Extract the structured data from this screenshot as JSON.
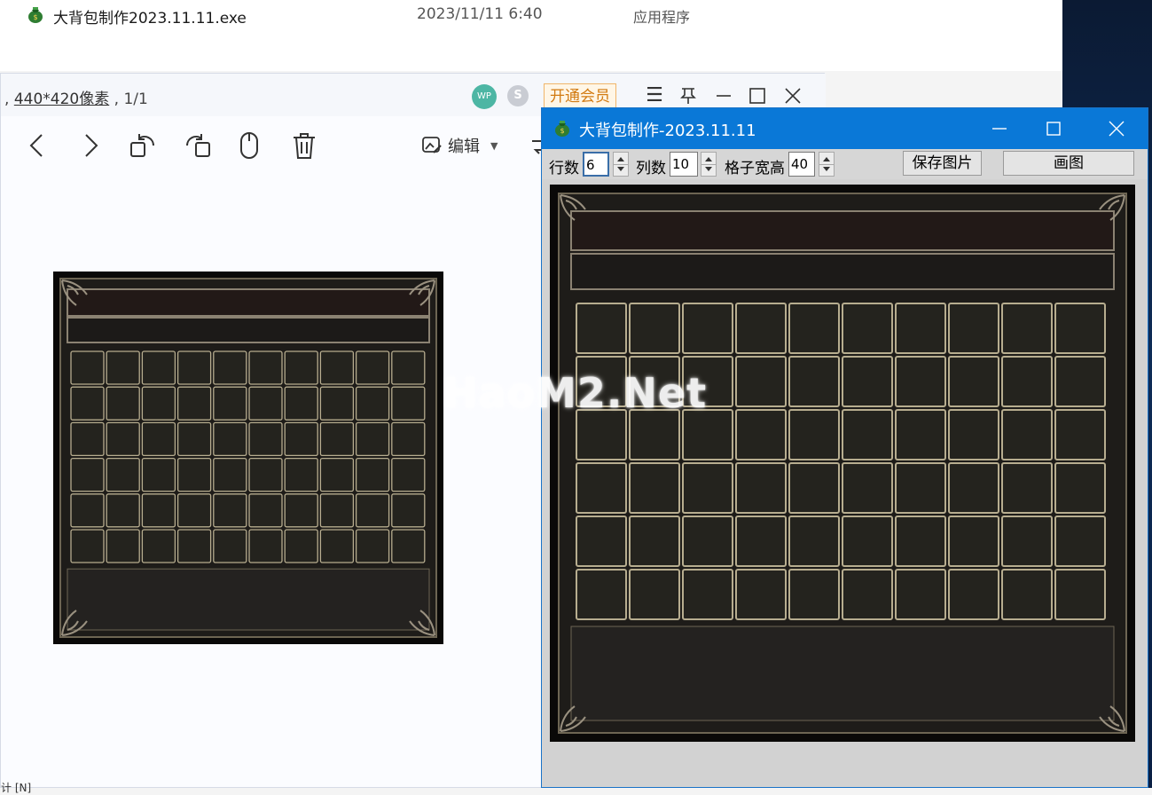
{
  "explorer": {
    "file_name": "大背包制作2023.11.11.exe",
    "file_date": "2023/11/11 6:40",
    "file_type": "应用程序"
  },
  "viewer": {
    "info_dims": "440*420像素",
    "info_sep": " , ",
    "info_page": "1/1",
    "wp_badge": "WP",
    "s_badge": "S",
    "vip_label": "开通会员",
    "edit_label": "编辑",
    "status_text": "计 [N]"
  },
  "tool": {
    "title": "大背包制作-2023.11.11",
    "rows_label": "行数",
    "rows_value": "6",
    "cols_label": "列数",
    "cols_value": "10",
    "cell_label": "格子宽高",
    "cell_value": "40",
    "save_label": "保存图片",
    "draw_label": "画图"
  },
  "grid": {
    "rows": 6,
    "cols": 10
  },
  "colors": {
    "titlebar_blue": "#0a78d7",
    "frame_dark": "#1c1a17",
    "cell_border": "#b7ad8f"
  },
  "watermark": "HaoM2.Net"
}
